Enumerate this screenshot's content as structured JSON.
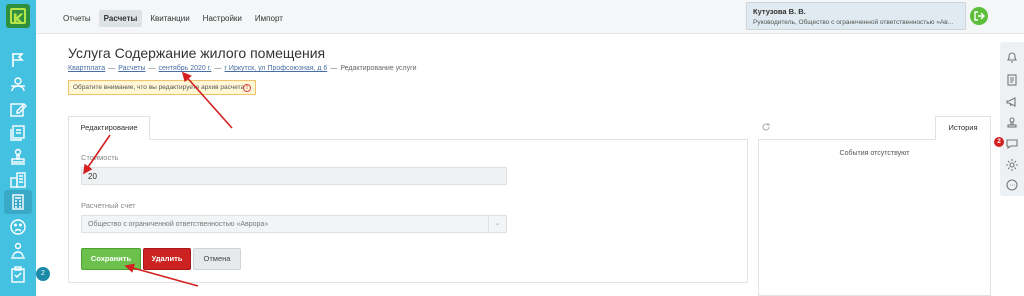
{
  "logo": {
    "letter": "K"
  },
  "topnav": {
    "items": [
      {
        "label": "Отчеты",
        "active": false
      },
      {
        "label": "Расчеты",
        "active": true
      },
      {
        "label": "Квитанции",
        "active": false
      },
      {
        "label": "Настройки",
        "active": false
      },
      {
        "label": "Импорт",
        "active": false
      }
    ]
  },
  "user": {
    "name": "Кутузова В. В.",
    "role": "Руководитель, Общество с ограниченной ответственностью «Ав..."
  },
  "sidebar": {
    "icons": [
      "flag-icon",
      "users-icon",
      "edit-icon",
      "documents-icon",
      "stamp-icon",
      "buildings-icon",
      "calculator-icon",
      "sad-face-icon",
      "org-structure-icon",
      "clipboard-icon"
    ],
    "badge": "2"
  },
  "rightrail": {
    "icons": [
      "bell-icon",
      "clipboard-list-icon",
      "megaphone-icon",
      "stamp-icon",
      "chat-icon",
      "settings-gear-icon",
      "support-chat-icon"
    ],
    "badge": "2"
  },
  "page": {
    "title": "Услуга Содержание жилого помещения",
    "breadcrumb": [
      {
        "label": "Квартплата",
        "link": true
      },
      {
        "label": "Расчеты",
        "link": true
      },
      {
        "label": "сентябрь 2020 г.",
        "link": true
      },
      {
        "label": "г Иркутск, ул Профсоюзная, д 6",
        "link": true
      },
      {
        "label": "Редактирование услуги",
        "link": false
      }
    ],
    "breadcrumb_sep": "—",
    "alert": "Обратите внимание, что вы редактируете архив расчета",
    "alert_icon": "!"
  },
  "edit_form": {
    "tab_label": "Редактирование",
    "cost_label": "Стоимость",
    "cost_value": "20",
    "account_label": "Расчетный счет",
    "account_value": "Общество с ограниченной ответственностью «Аврора»",
    "save_label": "Сохранить",
    "delete_label": "Удалить",
    "cancel_label": "Отмена"
  },
  "history": {
    "tab_label": "История",
    "empty_text": "События отсутствуют"
  },
  "colors": {
    "sidebar": "#44c0e0",
    "save": "#6cc14c",
    "delete": "#cc2222",
    "annotation_arrow": "#d42020"
  }
}
